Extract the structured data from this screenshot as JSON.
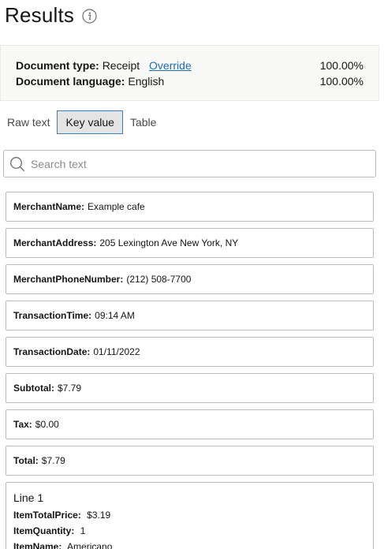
{
  "header": {
    "title": "Results",
    "info_icon": "info-icon"
  },
  "summary": {
    "document_type_label": "Document type:",
    "document_type_value": "Receipt",
    "override_link": "Override",
    "document_type_confidence": "100.00%",
    "document_language_label": "Document language:",
    "document_language_value": "English",
    "document_language_confidence": "100.00%"
  },
  "tabs": [
    {
      "label": "Raw text",
      "active": false
    },
    {
      "label": "Key value",
      "active": true
    },
    {
      "label": "Table",
      "active": false
    }
  ],
  "search": {
    "placeholder": "Search text",
    "value": "",
    "icon": "search-icon"
  },
  "fields": [
    {
      "key": "MerchantName:",
      "value": "Example cafe"
    },
    {
      "key": "MerchantAddress:",
      "value": "205 Lexington Ave New York, NY"
    },
    {
      "key": "MerchantPhoneNumber:",
      "value": "(212) 508-7700"
    },
    {
      "key": "TransactionTime:",
      "value": "09:14 AM"
    },
    {
      "key": "TransactionDate:",
      "value": "01/11/2022"
    },
    {
      "key": "Subtotal:",
      "value": "$7.79"
    },
    {
      "key": "Tax:",
      "value": "$0.00"
    },
    {
      "key": "Total:",
      "value": "$7.79"
    }
  ],
  "line_items": [
    {
      "title": "Line 1",
      "fields": [
        {
          "key": "ItemTotalPrice:",
          "value": "$3.19"
        },
        {
          "key": "ItemQuantity:",
          "value": "1"
        },
        {
          "key": "ItemName:",
          "value": "Americano"
        }
      ]
    }
  ],
  "colors": {
    "link": "#1d6db2",
    "active_tab_border": "#3d7eb8",
    "active_tab_bg": "#e4e4e4",
    "card_border": "#bcbab6"
  }
}
